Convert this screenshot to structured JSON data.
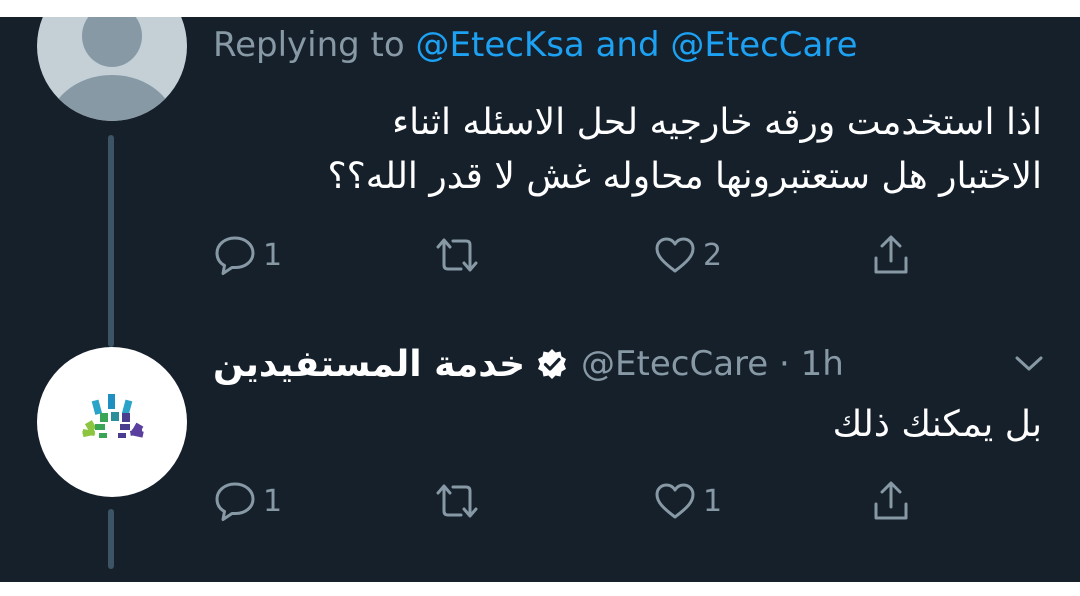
{
  "tweet1": {
    "reply_prefix": "Replying to",
    "mention_1": "@EtecKsa",
    "reply_conjunction": "and",
    "mention_2": "@EtecCare",
    "text_line_1": "اذا استخدمت ورقه خارجيه لحل الاسئله اثناء",
    "text_line_2": "الاختبار  هل ستعتبرونها محاوله غش لا قدر الله؟؟",
    "reply_count": "1",
    "like_count": "2"
  },
  "tweet2": {
    "display_name": "خدمة المستفيدين",
    "handle": "@EtecCare",
    "separator": "·",
    "time": "1h",
    "text": "بل يمكنك ذلك",
    "reply_count": "1",
    "like_count": "1"
  },
  "icons": {
    "reply": "reply-icon",
    "retweet": "retweet-icon",
    "like": "heart-icon",
    "share": "share-icon",
    "verified": "verified-badge-icon",
    "more": "chevron-down-icon"
  },
  "colors": {
    "background": "#15202b",
    "primary_text": "#ffffff",
    "secondary_text": "#8899a6",
    "link": "#1da1f2",
    "thread_line": "#3d5466"
  }
}
